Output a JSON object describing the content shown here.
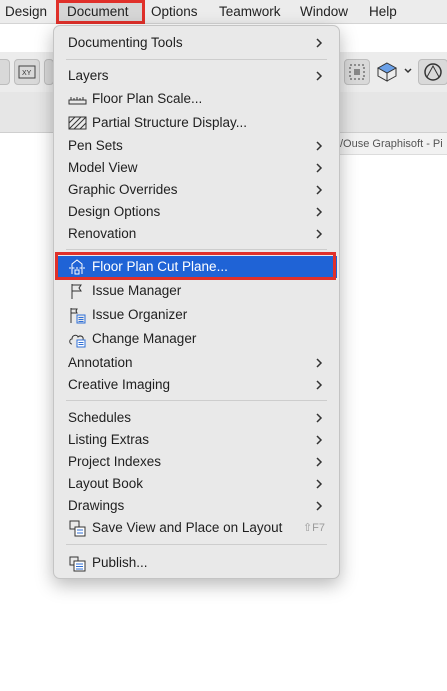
{
  "menubar": {
    "items": [
      "Design",
      "Document",
      "Options",
      "Teamwork",
      "Window",
      "Help"
    ],
    "active": "Document"
  },
  "background": {
    "project_title": "/Ouse Graphisoft  - Pi"
  },
  "menu": {
    "items": [
      {
        "label": "Documenting Tools",
        "submenu": true
      },
      {
        "label": "Layers",
        "submenu": true
      },
      {
        "label": "Floor Plan Scale...",
        "icon": "ruler-icon"
      },
      {
        "label": "Partial Structure Display...",
        "icon": "hatch-icon"
      },
      {
        "label": "Pen Sets",
        "submenu": true
      },
      {
        "label": "Model View",
        "submenu": true
      },
      {
        "label": "Graphic Overrides",
        "submenu": true
      },
      {
        "label": "Design Options",
        "submenu": true
      },
      {
        "label": "Renovation",
        "submenu": true
      },
      {
        "label": "Floor Plan Cut Plane...",
        "icon": "cut-plane-icon",
        "selected": true
      },
      {
        "label": "Issue Manager",
        "icon": "flag-icon"
      },
      {
        "label": "Issue Organizer",
        "icon": "issue-list-icon"
      },
      {
        "label": "Change Manager",
        "icon": "cloud-change-icon"
      },
      {
        "label": "Annotation",
        "submenu": true
      },
      {
        "label": "Creative Imaging",
        "submenu": true
      },
      {
        "label": "Schedules",
        "submenu": true
      },
      {
        "label": "Listing Extras",
        "submenu": true
      },
      {
        "label": "Project Indexes",
        "submenu": true
      },
      {
        "label": "Layout Book",
        "submenu": true
      },
      {
        "label": "Drawings",
        "submenu": true
      },
      {
        "label": "Save View and Place on Layout",
        "icon": "save-view-icon",
        "shortcut": "⇧F7"
      },
      {
        "label": "Publish...",
        "icon": "publish-icon"
      }
    ]
  },
  "colors": {
    "selection": "#1f63d6",
    "highlight_outline": "#e0302a",
    "menu_bg": "#e9e9e9"
  }
}
